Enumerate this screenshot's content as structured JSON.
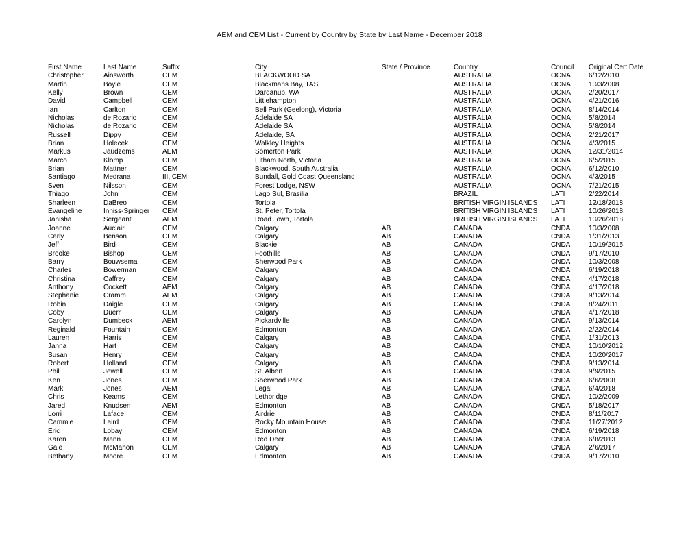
{
  "document": {
    "title": "AEM and CEM List - Current by Country by State by Last Name - December 2018"
  },
  "table": {
    "columns": [
      {
        "key": "first_name",
        "label": "First Name"
      },
      {
        "key": "last_name",
        "label": "Last Name"
      },
      {
        "key": "suffix",
        "label": "Suffix"
      },
      {
        "key": "city",
        "label": "City"
      },
      {
        "key": "state",
        "label": "State / Province"
      },
      {
        "key": "country",
        "label": "Country"
      },
      {
        "key": "council",
        "label": "Council"
      },
      {
        "key": "cert_date",
        "label": "Original Cert Date"
      }
    ],
    "rows": [
      [
        "Christopher",
        "Ainsworth",
        "CEM",
        "BLACKWOOD SA",
        "",
        "AUSTRALIA",
        "OCNA",
        "6/12/2010"
      ],
      [
        "Martin",
        "Boyle",
        "CEM",
        "Blackmans Bay, TAS",
        "",
        "AUSTRALIA",
        "OCNA",
        "10/3/2008"
      ],
      [
        "Kelly",
        "Brown",
        "CEM",
        "Dardanup, WA",
        "",
        "AUSTRALIA",
        "OCNA",
        "2/20/2017"
      ],
      [
        "David",
        "Campbell",
        "CEM",
        "Littlehampton",
        "",
        "AUSTRALIA",
        "OCNA",
        "4/21/2016"
      ],
      [
        "Ian",
        "Carlton",
        "CEM",
        "Bell Park (Geelong), Victoria",
        "",
        "AUSTRALIA",
        "OCNA",
        "8/14/2014"
      ],
      [
        "Nicholas",
        "de Rozario",
        "CEM",
        "Adelaide SA",
        "",
        "AUSTRALIA",
        "OCNA",
        "5/8/2014"
      ],
      [
        "Nicholas",
        "de Rozario",
        "CEM",
        "Adelaide SA",
        "",
        "AUSTRALIA",
        "OCNA",
        "5/8/2014"
      ],
      [
        "Russell",
        "Dippy",
        "CEM",
        "Adelaide, SA",
        "",
        "AUSTRALIA",
        "OCNA",
        "2/21/2017"
      ],
      [
        "Brian",
        "Holecek",
        "CEM",
        "Walkley Heights",
        "",
        "AUSTRALIA",
        "OCNA",
        "4/3/2015"
      ],
      [
        "Markus",
        "Jaudzems",
        "AEM",
        "Somerton Park",
        "",
        "AUSTRALIA",
        "OCNA",
        "12/31/2014"
      ],
      [
        "Marco",
        "Klomp",
        "CEM",
        "Eltham North, Victoria",
        "",
        "AUSTRALIA",
        "OCNA",
        "6/5/2015"
      ],
      [
        "Brian",
        "Mattner",
        "CEM",
        "Blackwood, South Australia",
        "",
        "AUSTRALIA",
        "OCNA",
        "6/12/2010"
      ],
      [
        "Santiago",
        "Medrana",
        "III, CEM",
        "Bundall, Gold Coast Queensland",
        "",
        "AUSTRALIA",
        "OCNA",
        "4/3/2015"
      ],
      [
        "Sven",
        "Nilsson",
        "CEM",
        "Forest Lodge, NSW",
        "",
        "AUSTRALIA",
        "OCNA",
        "7/21/2015"
      ],
      [
        "Thiago",
        "John",
        "CEM",
        "Lago Sul, Brasilia",
        "",
        "BRAZIL",
        "LATI",
        "2/22/2014"
      ],
      [
        "Sharleen",
        "DaBreo",
        "CEM",
        "Tortola",
        "",
        "BRITISH VIRGIN ISLANDS",
        "LATI",
        "12/18/2018"
      ],
      [
        "Evangeline",
        "Inniss-Springer",
        "CEM",
        "St. Peter, Tortola",
        "",
        "BRITISH VIRGIN ISLANDS",
        "LATI",
        "10/26/2018"
      ],
      [
        "Janisha",
        "Sergeant",
        "AEM",
        "Road Town, Tortola",
        "",
        "BRITISH VIRGIN ISLANDS",
        "LATI",
        "10/26/2018"
      ],
      [
        "Joanne",
        "Auclair",
        "CEM",
        "Calgary",
        "AB",
        "CANADA",
        "CNDA",
        "10/3/2008"
      ],
      [
        "Carly",
        "Benson",
        "CEM",
        "Calgary",
        "AB",
        "CANADA",
        "CNDA",
        "1/31/2013"
      ],
      [
        "Jeff",
        "Bird",
        "CEM",
        "Blackie",
        "AB",
        "CANADA",
        "CNDA",
        "10/19/2015"
      ],
      [
        "Brooke",
        "Bishop",
        "CEM",
        "Foothills",
        "AB",
        "CANADA",
        "CNDA",
        "9/17/2010"
      ],
      [
        "Barry",
        "Bouwsema",
        "CEM",
        "Sherwood Park",
        "AB",
        "CANADA",
        "CNDA",
        "10/3/2008"
      ],
      [
        "Charles",
        "Bowerman",
        "CEM",
        "Calgary",
        "AB",
        "CANADA",
        "CNDA",
        "6/19/2018"
      ],
      [
        "Christina",
        "Caffrey",
        "CEM",
        "Calgary",
        "AB",
        "CANADA",
        "CNDA",
        "4/17/2018"
      ],
      [
        "Anthony",
        "Cockett",
        "AEM",
        "Calgary",
        "AB",
        "CANADA",
        "CNDA",
        "4/17/2018"
      ],
      [
        "Stephanie",
        "Cramm",
        "AEM",
        "Calgary",
        "AB",
        "CANADA",
        "CNDA",
        "9/13/2014"
      ],
      [
        "Robin",
        "Daigle",
        "CEM",
        "Calgary",
        "AB",
        "CANADA",
        "CNDA",
        "8/24/2011"
      ],
      [
        "Coby",
        "Duerr",
        "CEM",
        "Calgary",
        "AB",
        "CANADA",
        "CNDA",
        "4/17/2018"
      ],
      [
        "Carolyn",
        "Dumbeck",
        "AEM",
        "Pickardville",
        "AB",
        "CANADA",
        "CNDA",
        "9/13/2014"
      ],
      [
        "Reginald",
        "Fountain",
        "CEM",
        "Edmonton",
        "AB",
        "CANADA",
        "CNDA",
        "2/22/2014"
      ],
      [
        "Lauren",
        "Harris",
        "CEM",
        "Calgary",
        "AB",
        "CANADA",
        "CNDA",
        "1/31/2013"
      ],
      [
        "Janna",
        "Hart",
        "CEM",
        "Calgary",
        "AB",
        "CANADA",
        "CNDA",
        "10/10/2012"
      ],
      [
        "Susan",
        "Henry",
        "CEM",
        "Calgary",
        "AB",
        "CANADA",
        "CNDA",
        "10/20/2017"
      ],
      [
        "Robert",
        "Holland",
        "CEM",
        "Calgary",
        "AB",
        "CANADA",
        "CNDA",
        "9/13/2014"
      ],
      [
        "Phil",
        "Jewell",
        "CEM",
        "St. Albert",
        "AB",
        "CANADA",
        "CNDA",
        "9/9/2015"
      ],
      [
        "Ken",
        "Jones",
        "CEM",
        "Sherwood Park",
        "AB",
        "CANADA",
        "CNDA",
        "6/6/2008"
      ],
      [
        "Mark",
        "Jones",
        "AEM",
        "Legal",
        "AB",
        "CANADA",
        "CNDA",
        "6/4/2018"
      ],
      [
        "Chris",
        "Keams",
        "CEM",
        "Lethbridge",
        "AB",
        "CANADA",
        "CNDA",
        "10/2/2009"
      ],
      [
        "Jared",
        "Knudsen",
        "AEM",
        "Edmonton",
        "AB",
        "CANADA",
        "CNDA",
        "5/18/2017"
      ],
      [
        "Lorri",
        "Laface",
        "CEM",
        "Airdrie",
        "AB",
        "CANADA",
        "CNDA",
        "8/11/2017"
      ],
      [
        "Cammie",
        "Laird",
        "CEM",
        "Rocky Mountain House",
        "AB",
        "CANADA",
        "CNDA",
        "11/27/2012"
      ],
      [
        "Eric",
        "Lobay",
        "CEM",
        "Edmonton",
        "AB",
        "CANADA",
        "CNDA",
        "6/19/2018"
      ],
      [
        "Karen",
        "Mann",
        "CEM",
        "Red Deer",
        "AB",
        "CANADA",
        "CNDA",
        "6/8/2013"
      ],
      [
        "Gale",
        "McMahon",
        "CEM",
        "Calgary",
        "AB",
        "CANADA",
        "CNDA",
        "2/6/2017"
      ],
      [
        "Bethany",
        "Moore",
        "CEM",
        "Edmonton",
        "AB",
        "CANADA",
        "CNDA",
        "9/17/2010"
      ]
    ]
  }
}
